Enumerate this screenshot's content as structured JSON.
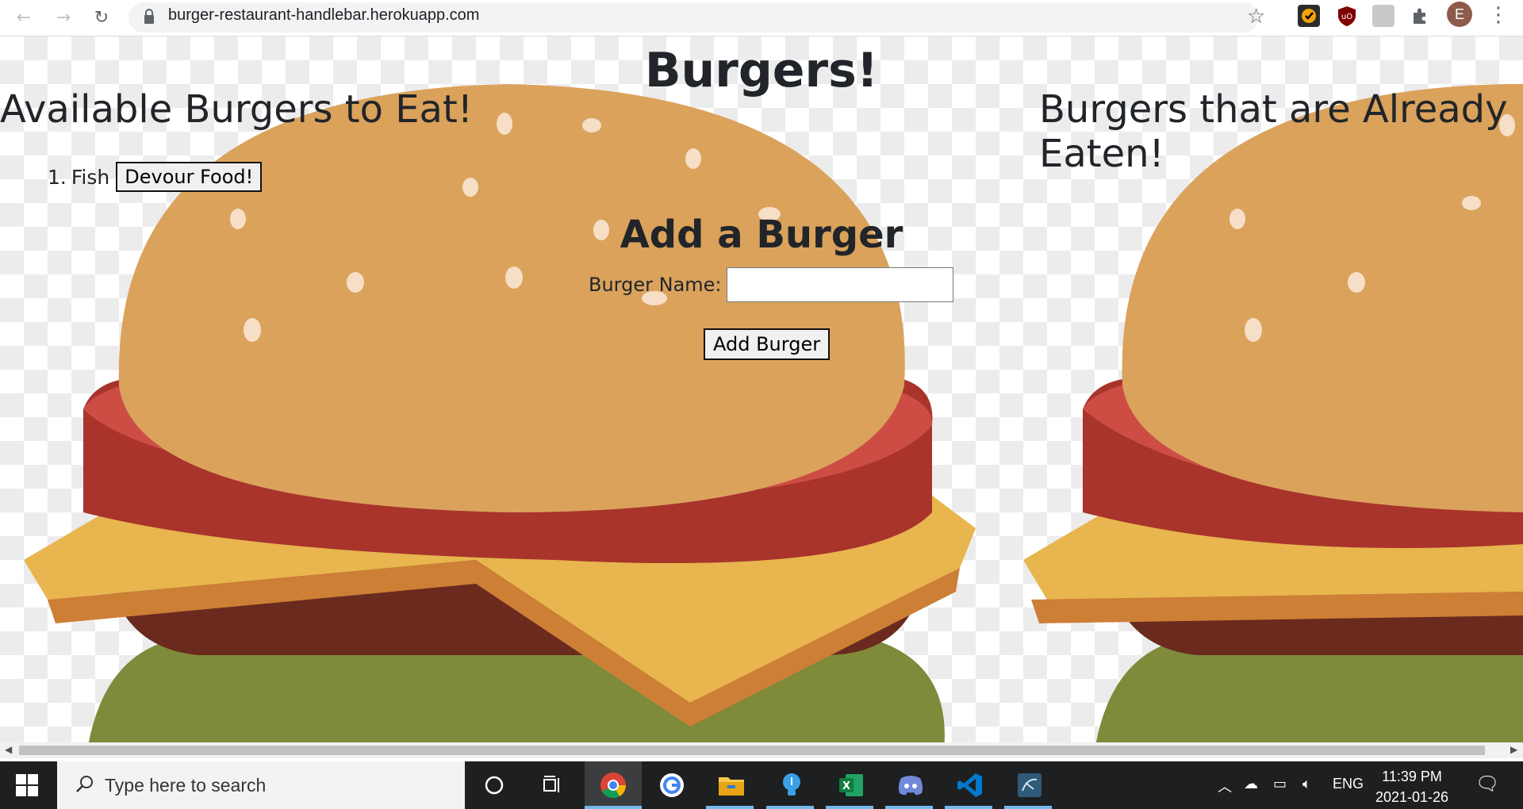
{
  "browser": {
    "url": "burger-restaurant-handlebar.herokuapp.com",
    "avatar_letter": "E"
  },
  "page": {
    "title": "Burgers!",
    "available_heading": "Available Burgers to Eat!",
    "eaten_heading_line1": "Burgers that are Already",
    "eaten_heading_line2": "Eaten!",
    "available_burgers": [
      {
        "number": "1.",
        "name": "Fish",
        "button": "Devour Food!"
      }
    ],
    "form": {
      "heading": "Add a Burger",
      "label": "Burger Name:",
      "input_value": "",
      "submit": "Add Burger"
    }
  },
  "taskbar": {
    "search_placeholder": "Type here to search",
    "language": "ENG",
    "time": "11:39 PM",
    "date": "2021-01-26"
  },
  "colors": {
    "bun": "#dba25c",
    "tomato": "#cd4d45",
    "cheese": "#e8b54e",
    "patty": "#6a2a1e",
    "lettuce": "#7f8a3b"
  }
}
